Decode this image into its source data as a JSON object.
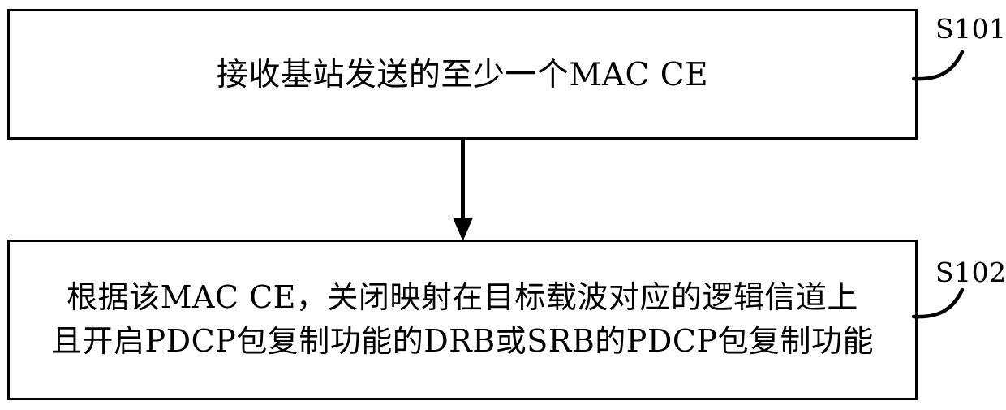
{
  "diagram": {
    "type": "flowchart",
    "orientation": "vertical",
    "background_color": "#ffffff",
    "line_color": "#000000",
    "steps": [
      {
        "id": "S101",
        "ref_label": "S101",
        "text": "接收基站发送的至少一个MAC CE",
        "lines": [
          "接收基站发送的至少一个MAC CE"
        ]
      },
      {
        "id": "S102",
        "ref_label": "S102",
        "text": "根据该MAC CE，关闭映射在目标载波对应的逻辑信道上\n且开启PDCP包复制功能的DRB或SRB的PDCP包复制功能",
        "lines": [
          "根据该MAC CE，关闭映射在目标载波对应的逻辑信道上",
          "且开启PDCP包复制功能的DRB或SRB的PDCP包复制功能"
        ]
      }
    ],
    "connector": {
      "from": "S101",
      "to": "S102",
      "style": "solid-line-with-filled-arrowhead",
      "direction": "down"
    }
  }
}
